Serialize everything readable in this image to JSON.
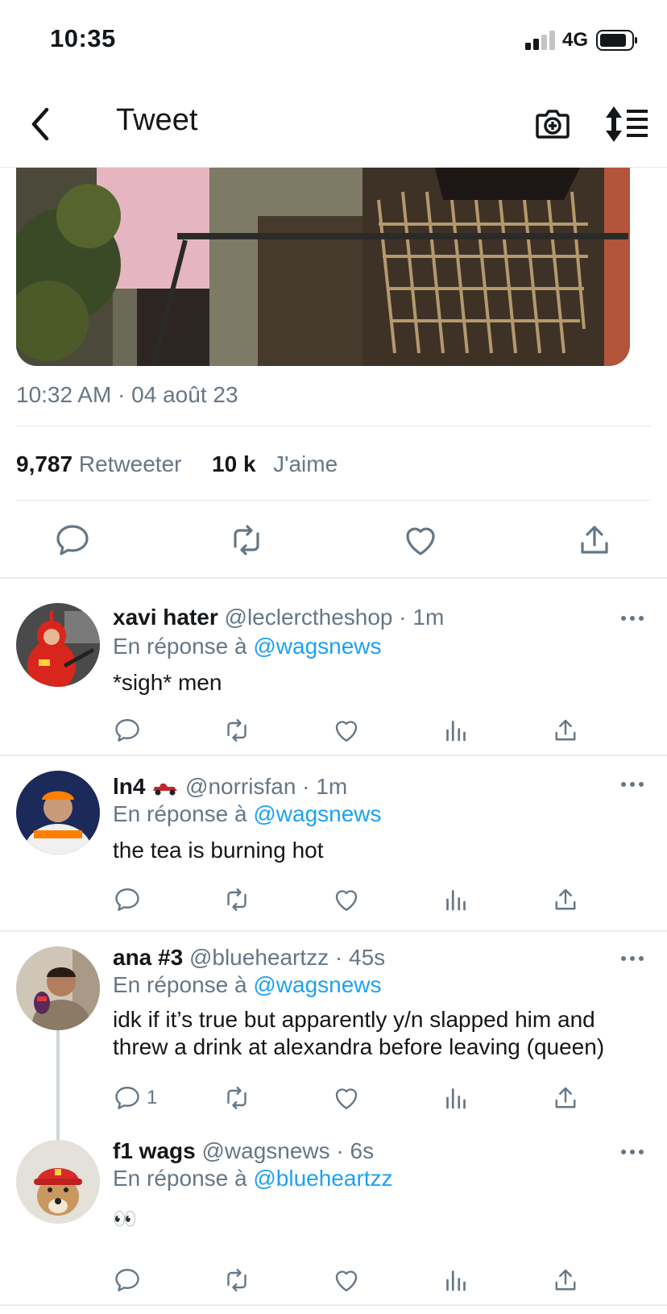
{
  "status_bar": {
    "time": "10:35",
    "network": "4G"
  },
  "nav": {
    "title": "Tweet"
  },
  "tweet": {
    "timestamp": "10:32 AM · 04 août 23",
    "retweets_count": "9,787",
    "retweets_label": "Retweeter",
    "likes_count": "10 k",
    "likes_label": "J'aime"
  },
  "replies": [
    {
      "name": "xavi hater",
      "handle": "@leclerctheshop · 1m",
      "reply_prefix": "En réponse à",
      "reply_to": "@wagsnews",
      "text": "*sigh* men",
      "reply_count": ""
    },
    {
      "name": "ln4",
      "handle": "@norrisfan · 1m",
      "reply_prefix": "En réponse à",
      "reply_to": "@wagsnews",
      "text": "the tea is burning hot",
      "reply_count": ""
    },
    {
      "name": "ana #3",
      "handle": "@blueheartzz · 45s",
      "reply_prefix": "En réponse à",
      "reply_to": "@wagsnews",
      "text": "idk if it’s true but apparently y/n slapped him and threw a drink at alexandra before leaving (queen)",
      "reply_count": "1"
    },
    {
      "name": "f1 wags",
      "handle": "@wagsnews · 6s",
      "reply_prefix": "En réponse à",
      "reply_to": "@blueheartzz",
      "text": "👀",
      "reply_count": ""
    }
  ],
  "colors": {
    "link": "#1da1f2",
    "muted": "#657786",
    "text": "#14171a",
    "border": "#e1e8ed"
  },
  "icons": [
    "chevron-left-icon",
    "camera-plus-icon",
    "sort-icon",
    "reply-icon",
    "retweet-icon",
    "like-icon",
    "share-icon",
    "analytics-icon",
    "more-icon"
  ]
}
